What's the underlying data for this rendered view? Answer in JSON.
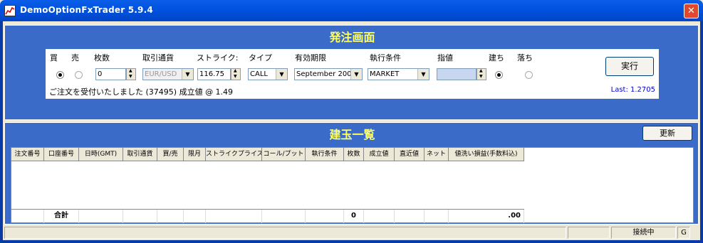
{
  "window": {
    "title": "DemoOptionFxTrader 5.9.4",
    "close_label": "✕"
  },
  "order": {
    "title": "発注画面",
    "labels": {
      "buy": "買",
      "sell": "売",
      "quantity": "枚数",
      "currency": "取引通貨",
      "strike": "ストライク:",
      "type": "タイプ",
      "expiry": "有効期限",
      "condition": "執行条件",
      "limit": "指値",
      "open": "建ち",
      "close": "落ち"
    },
    "buy_selected": true,
    "open_selected": true,
    "quantity_value": "0",
    "currency_value": "EUR/USD",
    "strike_value": "116.75",
    "type_value": "CALL",
    "expiry_value": "September 200",
    "condition_value": "MARKET",
    "limit_value": "",
    "execute_label": "実行",
    "status_message": "ご注文を受付いたしました (37495) 成立値 @ 1.49",
    "last_price": "Last:  1.2705"
  },
  "positions": {
    "title": "建玉一覧",
    "refresh_label": "更新",
    "columns": [
      "注文番号",
      "口座番号",
      "日時(GMT)",
      "取引通貨",
      "買/売",
      "限月",
      "ストライクプライス",
      "コール/プット",
      "執行条件",
      "枚数",
      "成立値",
      "直近値",
      "ネット",
      "値洗い損益(手数料込)"
    ],
    "total": {
      "label": "合計",
      "quantity": "0",
      "pnl": ".00"
    }
  },
  "statusbar": {
    "connection": "接続中",
    "mode": "G"
  }
}
